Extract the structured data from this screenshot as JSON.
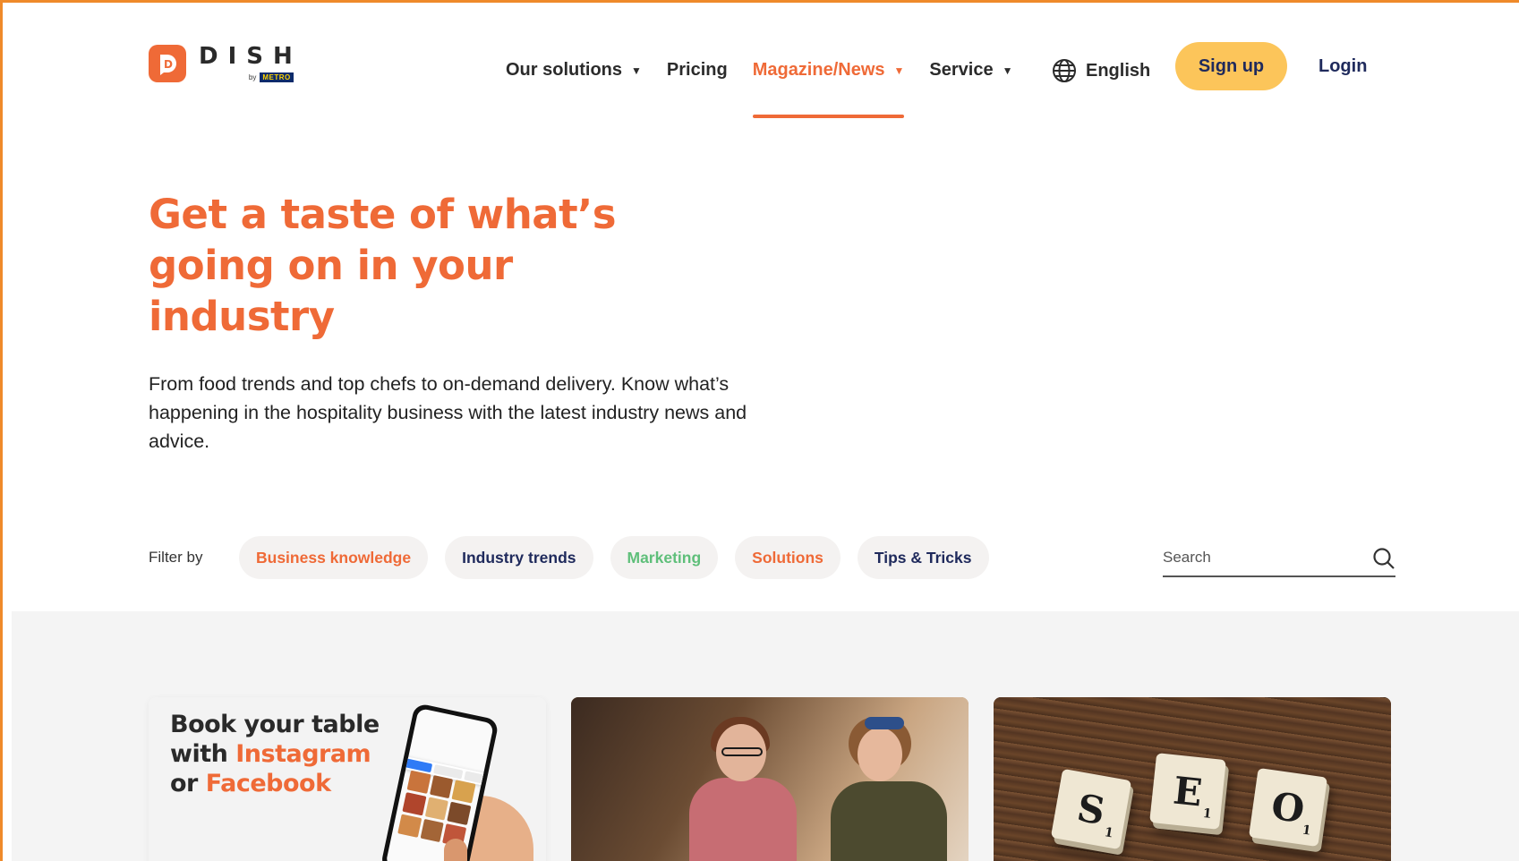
{
  "brand": {
    "name": "DISH",
    "by": "by",
    "parent": "METRO",
    "logo_letter": "D",
    "accent_color": "#ef6a37"
  },
  "nav": {
    "items": [
      {
        "label": "Our solutions",
        "has_dropdown": true,
        "active": false
      },
      {
        "label": "Pricing",
        "has_dropdown": false,
        "active": false
      },
      {
        "label": "Magazine/News",
        "has_dropdown": true,
        "active": true
      },
      {
        "label": "Service",
        "has_dropdown": true,
        "active": false
      }
    ],
    "caret": "▼",
    "language": "English",
    "language_icon": "globe-icon",
    "signup": "Sign up",
    "login": "Login"
  },
  "hero": {
    "title": "Get a taste of what’s going on in your industry",
    "subtitle": "From food trends and top chefs to on-demand delivery. Know what’s happening in the hospitality business with the latest industry news and advice."
  },
  "filter": {
    "label": "Filter by",
    "chips": [
      {
        "label": "Business knowledge",
        "color": "#ef6a37"
      },
      {
        "label": "Industry trends",
        "color": "#1f2a5c"
      },
      {
        "label": "Marketing",
        "color": "#5fbf7a"
      },
      {
        "label": "Solutions",
        "color": "#ef6a37"
      },
      {
        "label": "Tips & Tricks",
        "color": "#1f2a5c"
      }
    ],
    "search_placeholder": "Search",
    "search_icon": "magnifier-icon"
  },
  "cards": [
    {
      "type": "promo-image",
      "line1": "Book your table",
      "line2_pre": "with ",
      "line2_hl": "Instagram",
      "line3_pre": "or ",
      "line3_hl": "Facebook"
    },
    {
      "type": "photo",
      "subject": "two-women-talking"
    },
    {
      "type": "photo",
      "tiles": [
        {
          "letter": "S",
          "points": "1"
        },
        {
          "letter": "E",
          "points": "1"
        },
        {
          "letter": "O",
          "points": "1"
        }
      ]
    }
  ]
}
